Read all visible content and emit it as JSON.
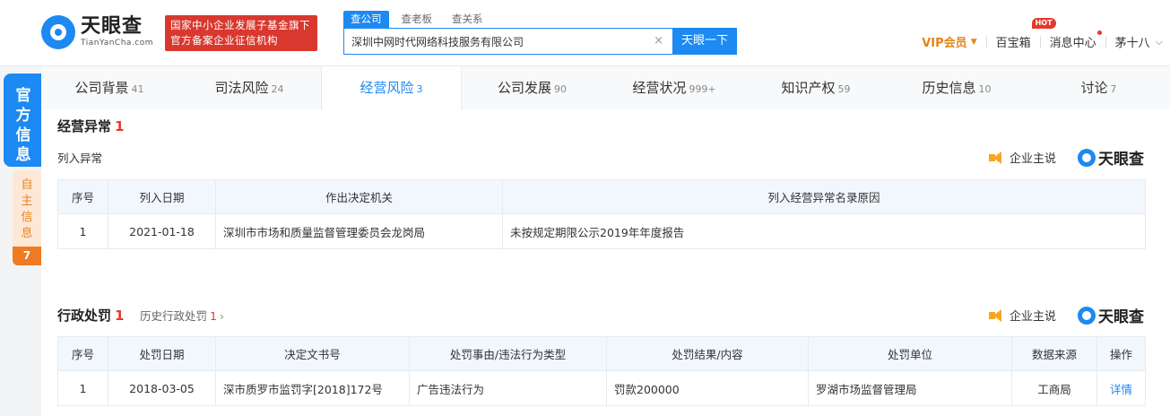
{
  "header": {
    "logo_cn": "天眼查",
    "logo_en": "TianYanCha.com",
    "slogan_line1": "国家中小企业发展子基金旗下",
    "slogan_line2": "官方备案企业征信机构",
    "search_tabs": [
      "查公司",
      "查老板",
      "查关系"
    ],
    "search_value": "深圳中网时代网络科技服务有限公司",
    "search_button": "天眼一下",
    "vip": "VIP会员",
    "treasure": "百宝箱",
    "hot_badge": "HOT",
    "messages": "消息中心",
    "user": "茅十八"
  },
  "side": {
    "official": "官方信息",
    "self": "自主信息",
    "self_count": "7"
  },
  "tabs": [
    {
      "label": "公司背景",
      "count": "41"
    },
    {
      "label": "司法风险",
      "count": "24"
    },
    {
      "label": "经营风险",
      "count": "3"
    },
    {
      "label": "公司发展",
      "count": "90"
    },
    {
      "label": "经营状况",
      "count": "999+"
    },
    {
      "label": "知识产权",
      "count": "59"
    },
    {
      "label": "历史信息",
      "count": "10"
    },
    {
      "label": "讨论",
      "count": "7"
    }
  ],
  "abnormal": {
    "title": "经营异常",
    "count": "1",
    "sub_label": "列入异常",
    "speak": "企业主说",
    "brand": "天眼查",
    "columns": [
      "序号",
      "列入日期",
      "作出决定机关",
      "列入经营异常名录原因"
    ],
    "rows": [
      [
        "1",
        "2021-01-18",
        "深圳市市场和质量监督管理委员会龙岗局",
        "未按规定期限公示2019年年度报告"
      ]
    ]
  },
  "penalty": {
    "title": "行政处罚",
    "count": "1",
    "history_label": "历史行政处罚",
    "history_count": "1",
    "speak": "企业主说",
    "brand": "天眼查",
    "columns": [
      "序号",
      "处罚日期",
      "决定文书号",
      "处罚事由/违法行为类型",
      "处罚结果/内容",
      "处罚单位",
      "数据来源",
      "操作"
    ],
    "rows": [
      [
        "1",
        "2018-03-05",
        "深市质罗市监罚字[2018]172号",
        "广告违法行为",
        "罚款200000",
        "罗湖市场监督管理局",
        "工商局",
        "详情"
      ]
    ]
  }
}
